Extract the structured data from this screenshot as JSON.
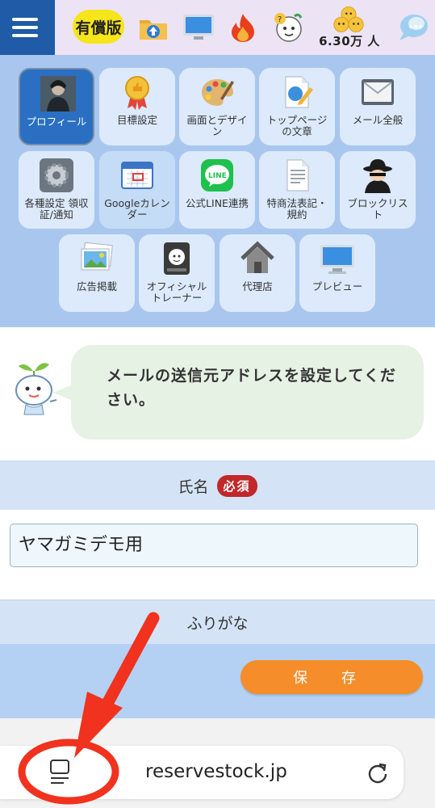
{
  "header": {
    "paid_badge": "有償版",
    "member_count": "6.30万 人",
    "icons": [
      "upload-folder-icon",
      "monitor-icon",
      "fire-icon",
      "question-mascot-icon",
      "coins-icon",
      "chat-bubble-icon"
    ]
  },
  "tiles": [
    {
      "label": "プロフィール",
      "icon": "profile-photo-icon",
      "active": true
    },
    {
      "label": "目標設定",
      "icon": "medal-icon"
    },
    {
      "label": "画面とデザイン",
      "icon": "palette-icon"
    },
    {
      "label": "トップページの文章",
      "icon": "document-pen-icon"
    },
    {
      "label": "メール全般",
      "icon": "envelope-icon"
    },
    {
      "label": "各種設定 領収証/通知",
      "icon": "gear-icon"
    },
    {
      "label": "Googleカレンダー",
      "icon": "calendar-icon"
    },
    {
      "label": "公式LINE連携",
      "icon": "line-icon"
    },
    {
      "label": "特商法表記・規約",
      "icon": "document-icon"
    },
    {
      "label": "ブロックリスト",
      "icon": "spy-icon"
    },
    {
      "label": "広告掲載",
      "icon": "photos-icon"
    },
    {
      "label": "オフィシャルトレーナー",
      "icon": "trainer-badge-icon"
    },
    {
      "label": "代理店",
      "icon": "house-icon"
    },
    {
      "label": "プレビュー",
      "icon": "monitor-icon"
    }
  ],
  "message": {
    "text": "メールの送信元アドレスを設定してください。"
  },
  "form": {
    "name_label": "氏名",
    "required_badge": "必須",
    "name_value": "ヤマガミデモ用",
    "kana_label": "ふりがな",
    "save_label": "保 存"
  },
  "browser": {
    "url": "reservestock.jp"
  },
  "colors": {
    "menu": "#1f5ba6",
    "tile_bg": "#dceafb",
    "grid_bg": "#a9c7ee",
    "active_tile": "#2b6fc2",
    "required": "#c0282a",
    "save": "#f48d2a",
    "annotation": "#f0321e"
  }
}
